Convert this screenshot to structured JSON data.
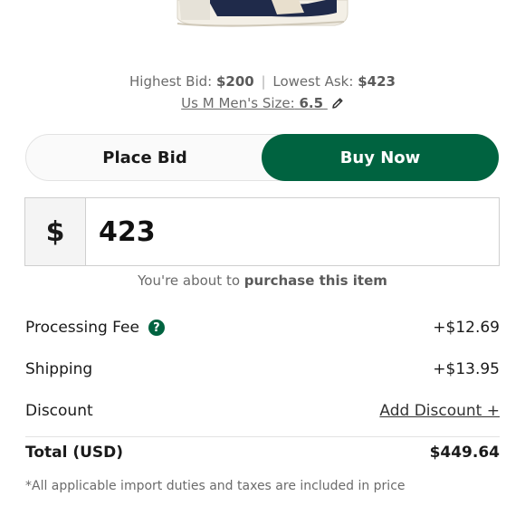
{
  "product": {
    "image_icon": "sneaker-image"
  },
  "market": {
    "highest_bid_label": "Highest Bid:",
    "highest_bid_value": "$200",
    "separator": "|",
    "lowest_ask_label": "Lowest Ask:",
    "lowest_ask_value": "$423",
    "size_label": "Us M Men's Size:",
    "size_value": "6.5",
    "edit_icon": "pencil-icon"
  },
  "mode_toggle": {
    "place_bid_label": "Place Bid",
    "buy_now_label": "Buy Now",
    "selected": "Buy Now"
  },
  "price_input": {
    "currency_symbol": "$",
    "amount": "423"
  },
  "purchase_note": {
    "prefix": "You're about to",
    "bold": "purchase this item"
  },
  "fees": {
    "processing_label": "Processing Fee",
    "processing_value": "+$12.69",
    "help_icon": "question-circle-icon",
    "shipping_label": "Shipping",
    "shipping_value": "+$13.95",
    "discount_label": "Discount",
    "add_discount_label": "Add Discount +",
    "total_label": "Total (USD)",
    "total_value": "$449.64"
  },
  "footnote": "*All applicable import duties and taxes are included in price",
  "colors": {
    "accent_green": "#006340",
    "muted_text": "#6b6b6b"
  }
}
